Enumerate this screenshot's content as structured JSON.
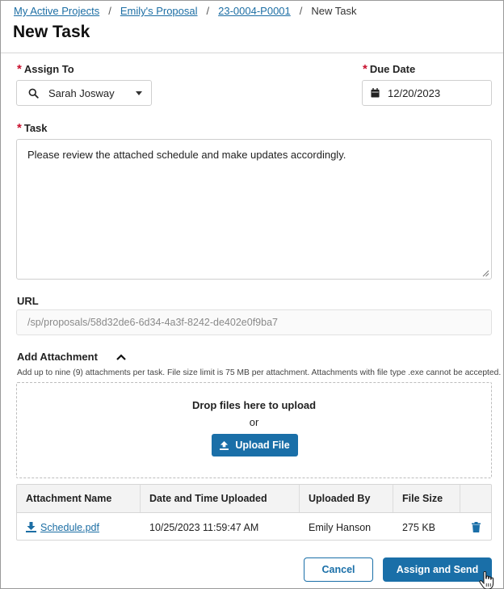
{
  "breadcrumb": {
    "items": [
      "My Active Projects",
      "Emily's Proposal",
      "23-0004-P0001"
    ],
    "current": "New Task",
    "separator": "/"
  },
  "page_title": "New Task",
  "form": {
    "assign_to": {
      "label": "Assign To",
      "value": "Sarah Josway",
      "icon": "search-icon"
    },
    "due_date": {
      "label": "Due Date",
      "value": "12/20/2023",
      "icon": "calendar-icon"
    },
    "task": {
      "label": "Task",
      "value": "Please review the attached schedule and make updates accordingly."
    },
    "url": {
      "label": "URL",
      "value": "/sp/proposals/58d32de6-6d34-4a3f-8242-de402e0f9ba7"
    }
  },
  "attachments": {
    "label": "Add Attachment",
    "hint": "Add up to nine (9) attachments per task. File size limit is 75 MB per attachment. Attachments with file type .exe cannot be accepted.",
    "drop_title": "Drop files here to upload",
    "drop_or": "or",
    "upload_label": "Upload File",
    "columns": [
      "Attachment Name",
      "Date and Time Uploaded",
      "Uploaded By",
      "File Size"
    ],
    "rows": [
      {
        "name": "Schedule.pdf",
        "uploaded": "10/25/2023 11:59:47 AM",
        "by": "Emily Hanson",
        "size": "275 KB"
      }
    ]
  },
  "actions": {
    "cancel": "Cancel",
    "submit": "Assign and Send"
  },
  "colors": {
    "primary": "#1a6fa8",
    "link": "#1c6ea4",
    "required": "#c8102e"
  }
}
